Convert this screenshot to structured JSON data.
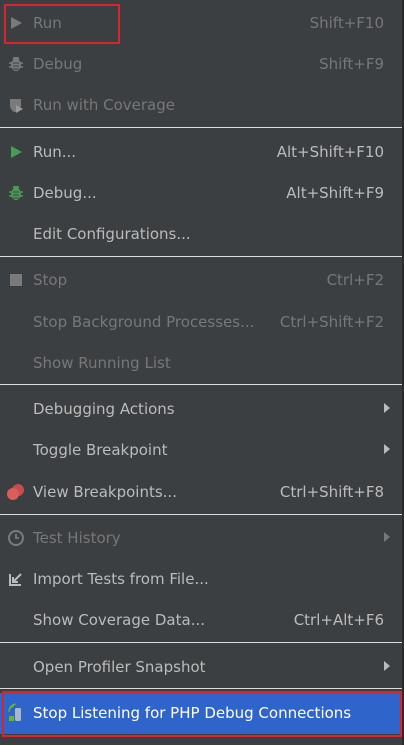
{
  "menu": {
    "items": [
      {
        "label": "Run",
        "shortcut": "Shift+F10"
      },
      {
        "label": "Debug",
        "shortcut": "Shift+F9"
      },
      {
        "label": "Run with Coverage",
        "shortcut": ""
      },
      {
        "label": "Run...",
        "shortcut": "Alt+Shift+F10"
      },
      {
        "label": "Debug...",
        "shortcut": "Alt+Shift+F9"
      },
      {
        "label": "Edit Configurations...",
        "shortcut": ""
      },
      {
        "label": "Stop",
        "shortcut": "Ctrl+F2"
      },
      {
        "label": "Stop Background Processes...",
        "shortcut": "Ctrl+Shift+F2"
      },
      {
        "label": "Show Running List",
        "shortcut": ""
      },
      {
        "label": "Debugging Actions",
        "shortcut": ""
      },
      {
        "label": "Toggle Breakpoint",
        "shortcut": ""
      },
      {
        "label": "View Breakpoints...",
        "shortcut": "Ctrl+Shift+F8"
      },
      {
        "label": "Test History",
        "shortcut": ""
      },
      {
        "label": "Import Tests from File...",
        "shortcut": ""
      },
      {
        "label": "Show Coverage Data...",
        "shortcut": "Ctrl+Alt+F6"
      },
      {
        "label": "Open Profiler Snapshot",
        "shortcut": ""
      },
      {
        "label": "Stop Listening for PHP Debug Connections",
        "shortcut": ""
      }
    ]
  },
  "icons": {
    "run": "play-icon",
    "debug": "bug-icon",
    "coverage": "coverage-shield-icon",
    "stop": "stop-square-icon",
    "breakpoints": "breakpoints-icon",
    "history": "clock-icon",
    "import": "import-arrow-icon",
    "php": "phone-listen-icon"
  },
  "colors": {
    "background": "#3c3f41",
    "text": "#bbbbbb",
    "disabled_text": "#777777",
    "selection": "#2f65ca",
    "accent_green": "#499c54",
    "highlight_red": "#d8252b"
  }
}
